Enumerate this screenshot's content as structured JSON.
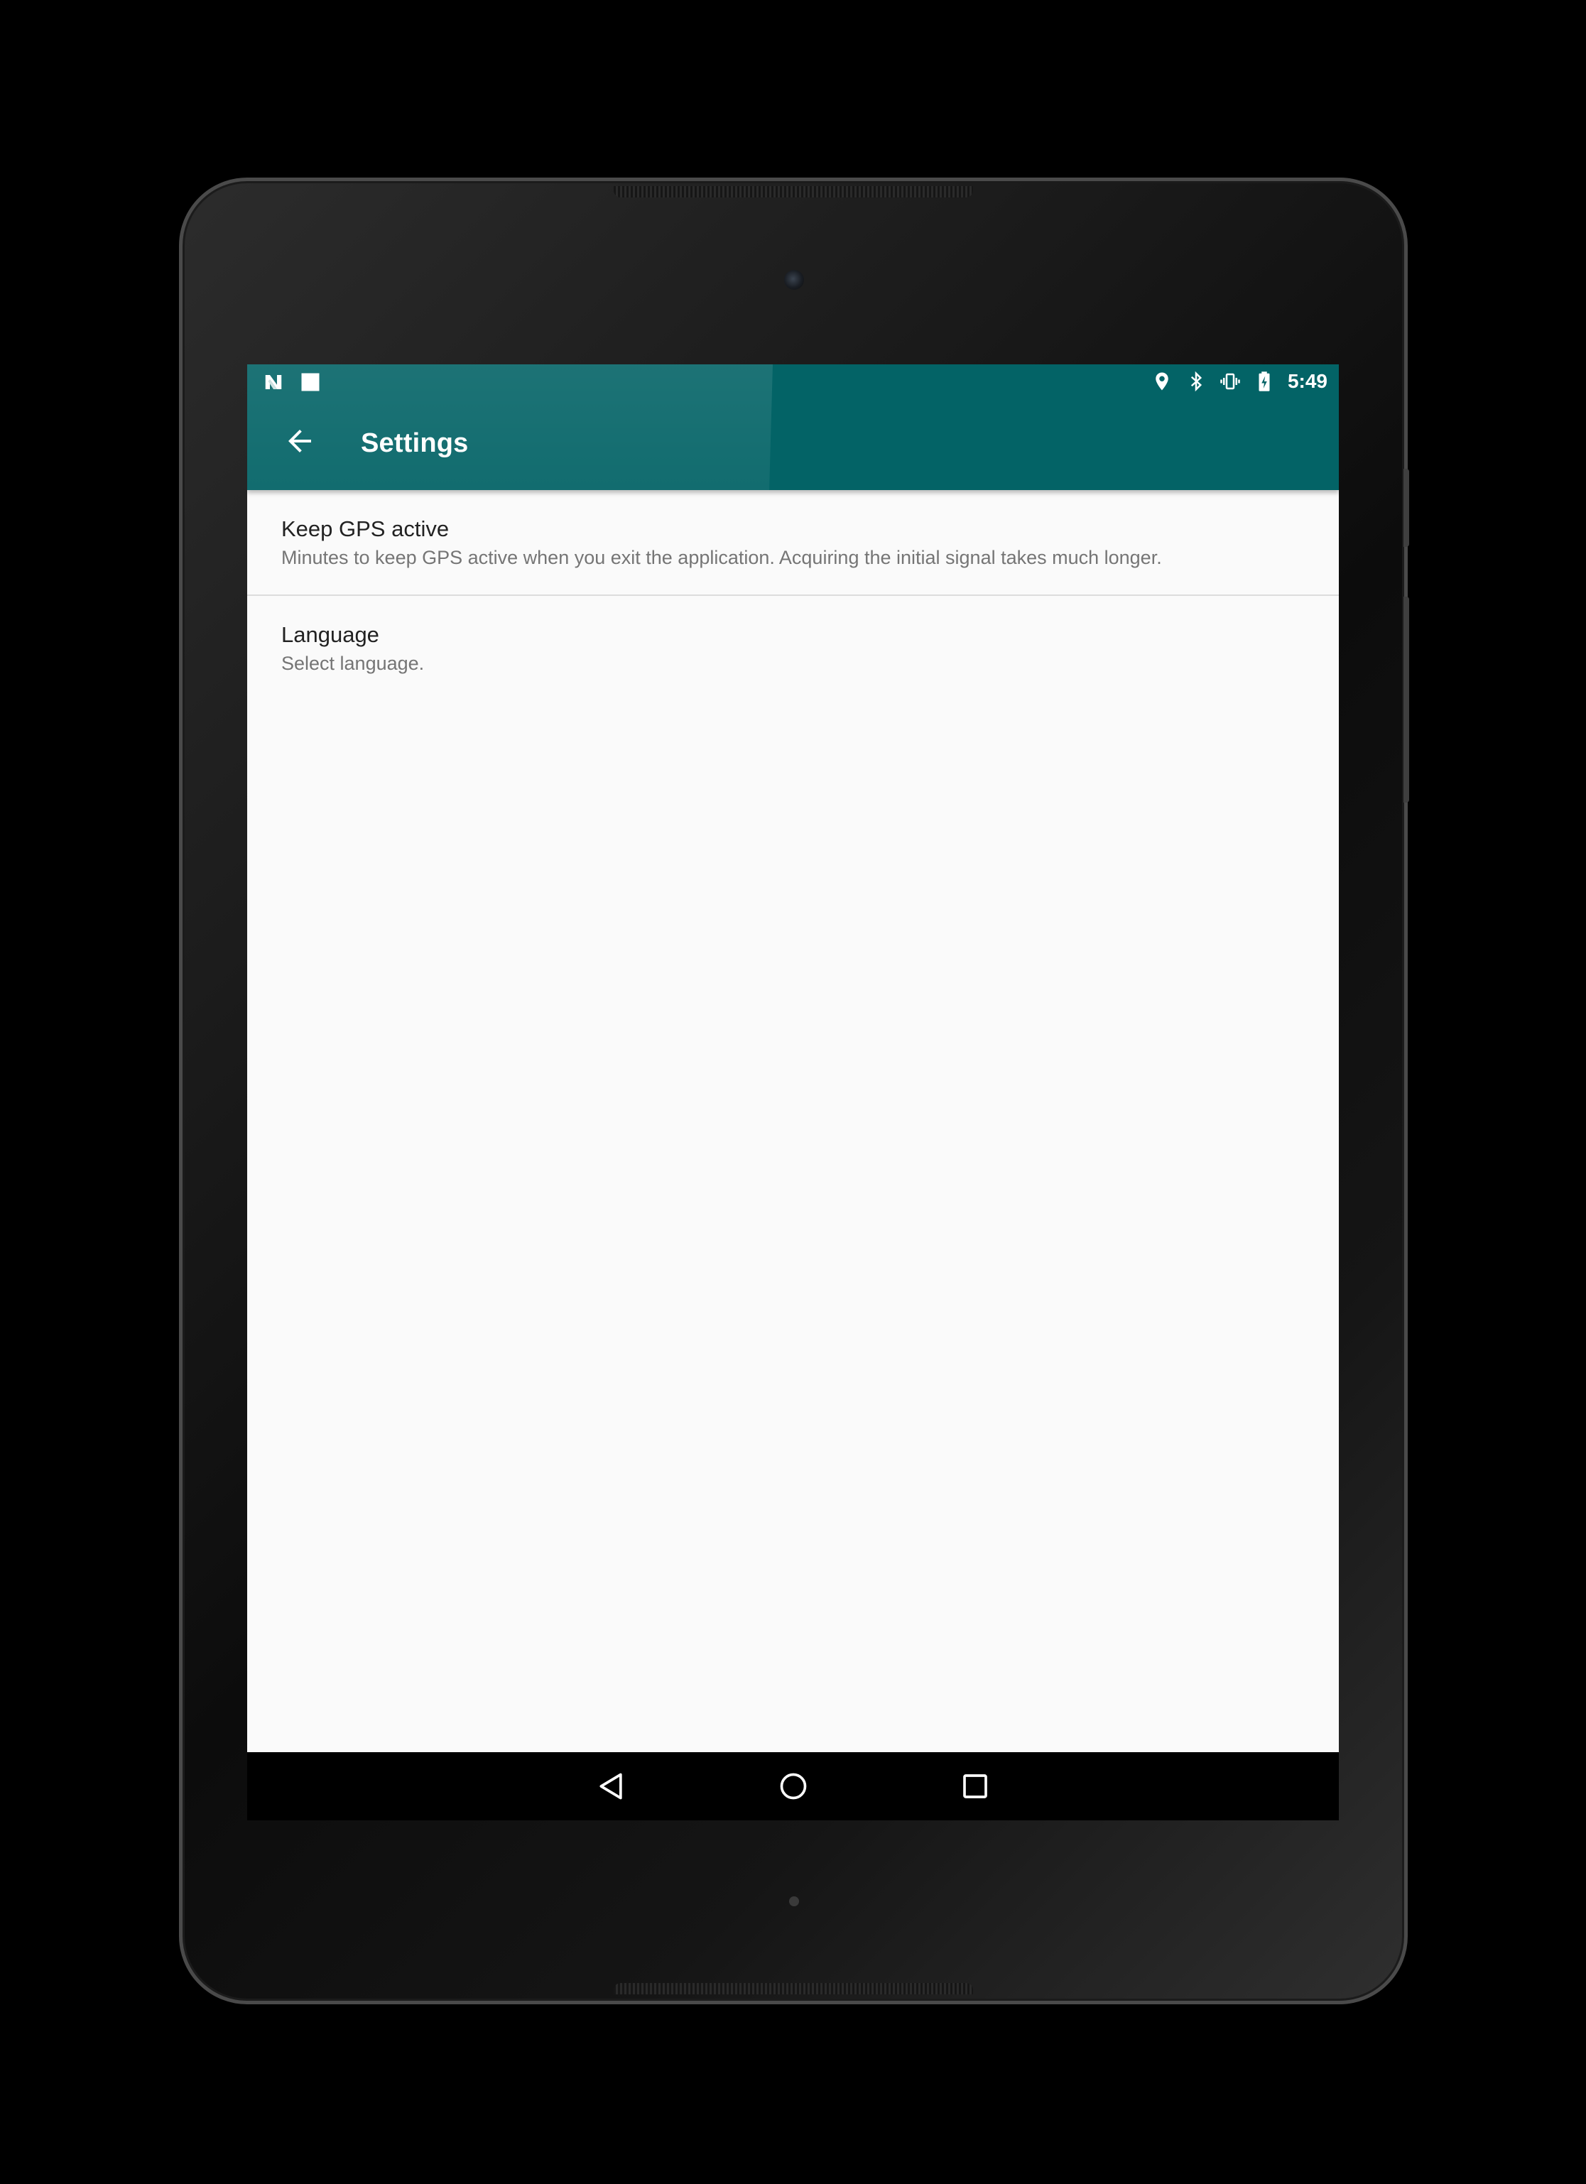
{
  "status_bar": {
    "time": "5:49",
    "left_icons": [
      "notification-n-icon",
      "notification-square-icon"
    ],
    "right_icons": [
      "location-icon",
      "bluetooth-icon",
      "vibrate-icon",
      "battery-charging-icon"
    ]
  },
  "toolbar": {
    "title": "Settings",
    "back_icon": "arrow-back-icon",
    "background_color": "#036366"
  },
  "preferences": [
    {
      "title": "Keep GPS active",
      "summary": "Minutes to keep GPS active when you exit the application. Acquiring the initial signal takes much longer."
    },
    {
      "title": "Language",
      "summary": "Select language."
    }
  ],
  "nav_bar": {
    "buttons": [
      "back-triangle-icon",
      "home-circle-icon",
      "recents-square-icon"
    ]
  }
}
